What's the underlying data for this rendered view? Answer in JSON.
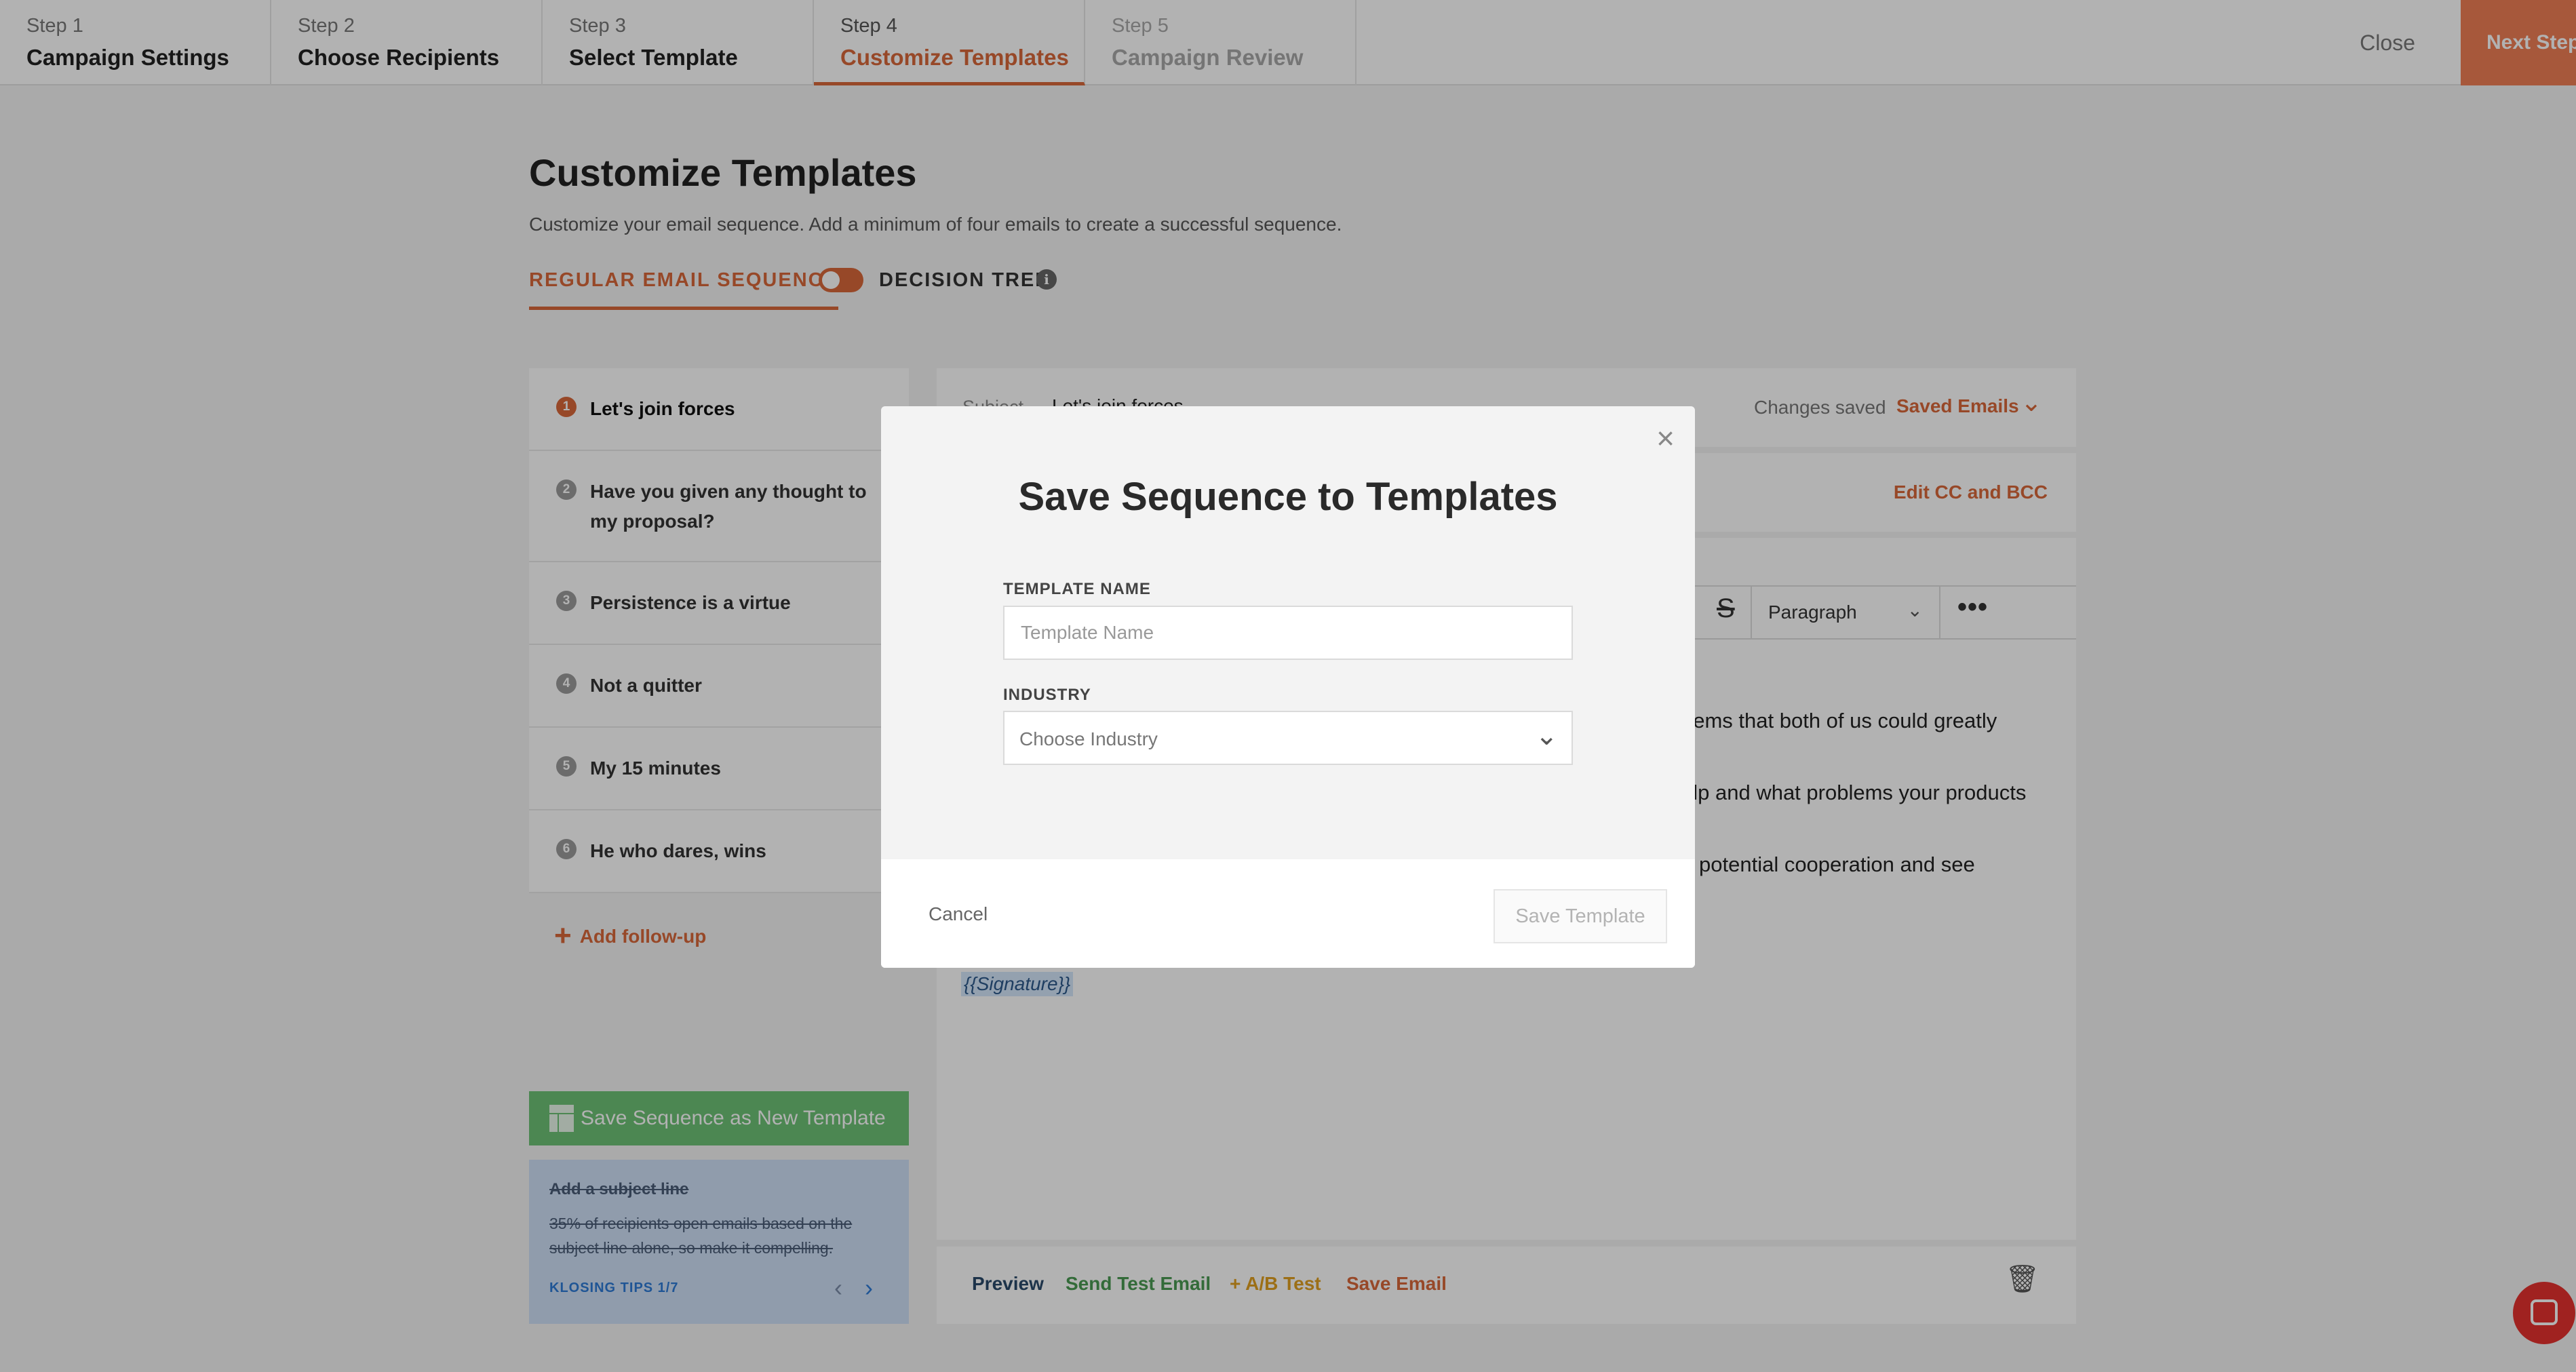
{
  "stepper": {
    "steps": [
      {
        "num": "Step 1",
        "name": "Campaign Settings"
      },
      {
        "num": "Step 2",
        "name": "Choose Recipients"
      },
      {
        "num": "Step 3",
        "name": "Select Template"
      },
      {
        "num": "Step 4",
        "name": "Customize Templates"
      },
      {
        "num": "Step 5",
        "name": "Campaign Review"
      }
    ],
    "active_step": 4,
    "close_label": "Close",
    "next_label": "Next Step"
  },
  "page": {
    "title": "Customize Templates",
    "subtitle": "Customize your email sequence. Add a minimum of four emails to create a successful sequence.",
    "tab_regular": "REGULAR EMAIL SEQUENCE",
    "tab_decision": "DECISION TREE",
    "info_glyph": "i"
  },
  "sequence": {
    "items": [
      {
        "n": "1",
        "label": "Let's join forces"
      },
      {
        "n": "2",
        "label": "Have you given any thought to my proposal?"
      },
      {
        "n": "3",
        "label": "Persistence is a virtue"
      },
      {
        "n": "4",
        "label": "Not a quitter"
      },
      {
        "n": "5",
        "label": "My 15 minutes"
      },
      {
        "n": "6",
        "label": "He who dares, wins"
      }
    ],
    "add_follow_up": "Add follow-up",
    "save_as_template": "Save Sequence as New Template"
  },
  "tips": {
    "title": "Add a subject line",
    "body": "35% of recipients open emails based on the subject line alone, so make it compelling.",
    "footer": "KLOSING TIPS 1/7"
  },
  "editor": {
    "subject_label": "Subject",
    "subject_value": "Let's join forces",
    "changes_saved": "Changes saved",
    "saved_emails": "Saved Emails",
    "edit_cc_bcc": "Edit CC and BCC",
    "paragraph_select": "Paragraph",
    "body_fragments": [
      "eems that both of us could greatly",
      "elp and what problems your products",
      "potential cooperation and see"
    ],
    "signature": "{{Signature}}",
    "footer": {
      "preview": "Preview",
      "send_test": "Send Test Email",
      "ab_test": "+ A/B Test",
      "save_email": "Save Email"
    }
  },
  "modal": {
    "title": "Save Sequence to Templates",
    "template_name_label": "TEMPLATE NAME",
    "template_name_placeholder": "Template Name",
    "template_name_value": "",
    "industry_label": "INDUSTRY",
    "industry_value": "Choose Industry",
    "cancel_label": "Cancel",
    "save_label": "Save Template"
  },
  "colors": {
    "accent": "#d9683a",
    "next_button": "#ef7f55",
    "save_sequence_green": "#6ec276",
    "tips_bg": "#cfe0f6",
    "chat_red": "#e5322e"
  }
}
